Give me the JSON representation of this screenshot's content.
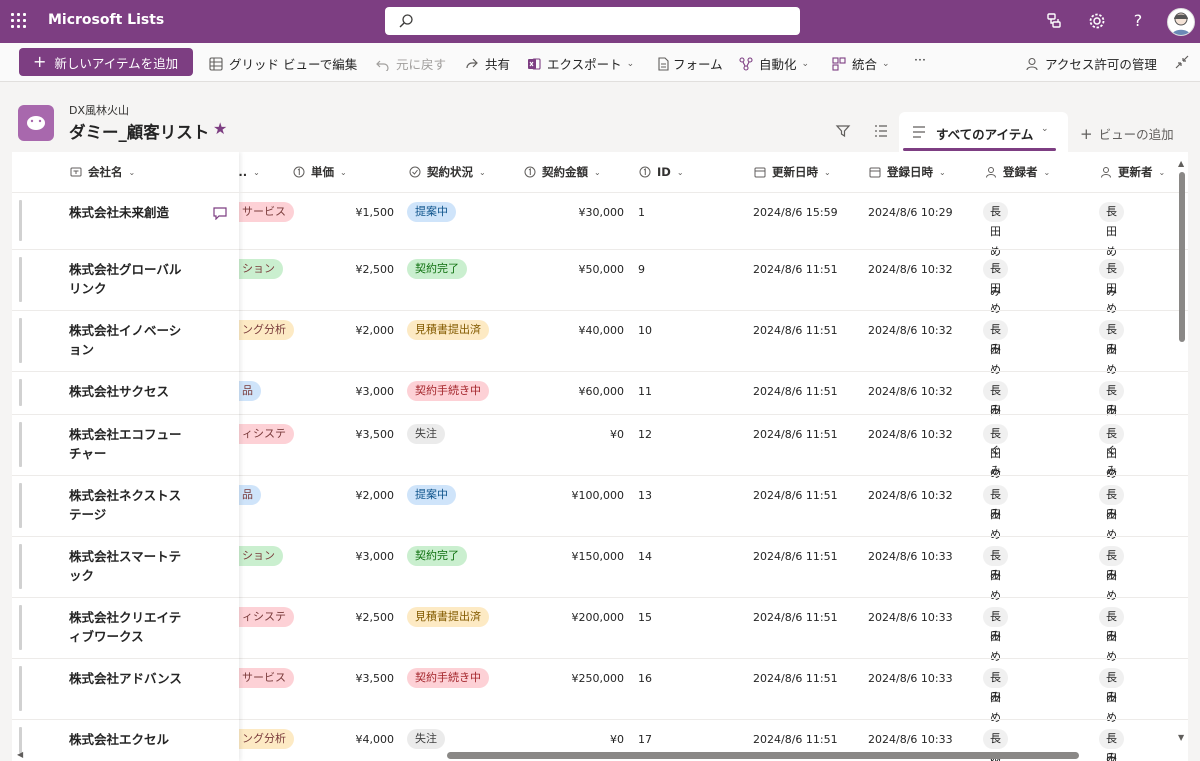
{
  "app": {
    "name": "Microsoft Lists"
  },
  "colors": {
    "brand": "#7d3e82",
    "pill_blue": "#cfe4fa",
    "pill_green": "#caefcf",
    "pill_yellow": "#fdeac4",
    "pill_red": "#fdd1d6",
    "pill_gray": "#ebebeb"
  },
  "commands": {
    "new_item": "新しいアイテムを追加",
    "grid_edit": "グリッド ビューで編集",
    "undo": "元に戻す",
    "share": "共有",
    "export": "エクスポート",
    "form": "フォーム",
    "automate": "自動化",
    "integrate": "統合",
    "more": "···",
    "access": "アクセス許可の管理"
  },
  "header": {
    "site": "DX風林火山",
    "list_title": "ダミー_顧客リスト",
    "view_name": "すべてのアイテム",
    "add_view": "ビューの追加"
  },
  "columns": {
    "company": "会社名",
    "product_trunc": "...",
    "unit_price": "単価",
    "status": "契約状況",
    "amount": "契約金額",
    "id": "ID",
    "modified": "更新日時",
    "created": "登録日時",
    "created_by": "登録者",
    "modified_by": "更新者"
  },
  "rows": [
    {
      "name": "株式会社未来創造",
      "product": "サービス",
      "price": "¥1,500",
      "status": "提案中",
      "amount": "¥30,000",
      "id": "1",
      "modified": "2024/8/6 15:59",
      "created": "2024/8/6 10:29",
      "created_by": "長田めぐみ",
      "modified_by": "長田めぐみ"
    },
    {
      "name": "株式会社グローバルリンク",
      "product": "ション",
      "price": "¥2,500",
      "status": "契約完了",
      "amount": "¥50,000",
      "id": "9",
      "modified": "2024/8/6 11:51",
      "created": "2024/8/6 10:32",
      "created_by": "長田めぐみ",
      "modified_by": "長田めぐみ"
    },
    {
      "name": "株式会社イノベーション",
      "product": "ング分析",
      "price": "¥2,000",
      "status": "見積書提出済",
      "amount": "¥40,000",
      "id": "10",
      "modified": "2024/8/6 11:51",
      "created": "2024/8/6 10:32",
      "created_by": "長田めぐみ",
      "modified_by": "長田めぐみ"
    },
    {
      "name": "株式会社サクセス",
      "product": "品",
      "price": "¥3,000",
      "status": "契約手続き中",
      "amount": "¥60,000",
      "id": "11",
      "modified": "2024/8/6 11:51",
      "created": "2024/8/6 10:32",
      "created_by": "長田めぐみ",
      "modified_by": "長田めぐみ"
    },
    {
      "name": "株式会社エコフューチャー",
      "product": "ィシステ",
      "price": "¥3,500",
      "status": "失注",
      "amount": "¥0",
      "id": "12",
      "modified": "2024/8/6 11:51",
      "created": "2024/8/6 10:32",
      "created_by": "長田めぐみ",
      "modified_by": "長田めぐみ"
    },
    {
      "name": "株式会社ネクストステージ",
      "product": "品",
      "price": "¥2,000",
      "status": "提案中",
      "amount": "¥100,000",
      "id": "13",
      "modified": "2024/8/6 11:51",
      "created": "2024/8/6 10:32",
      "created_by": "長田めぐみ",
      "modified_by": "長田めぐみ"
    },
    {
      "name": "株式会社スマートテック",
      "product": "ション",
      "price": "¥3,000",
      "status": "契約完了",
      "amount": "¥150,000",
      "id": "14",
      "modified": "2024/8/6 11:51",
      "created": "2024/8/6 10:33",
      "created_by": "長田めぐみ",
      "modified_by": "長田めぐみ"
    },
    {
      "name": "株式会社クリエイティブワークス",
      "product": "ィシステ",
      "price": "¥2,500",
      "status": "見積書提出済",
      "amount": "¥200,000",
      "id": "15",
      "modified": "2024/8/6 11:51",
      "created": "2024/8/6 10:33",
      "created_by": "長田めぐみ",
      "modified_by": "長田めぐみ"
    },
    {
      "name": "株式会社アドバンス",
      "product": "サービス",
      "price": "¥3,500",
      "status": "契約手続き中",
      "amount": "¥250,000",
      "id": "16",
      "modified": "2024/8/6 11:51",
      "created": "2024/8/6 10:33",
      "created_by": "長田めぐみ",
      "modified_by": "長田めぐみ"
    },
    {
      "name": "株式会社エクセル",
      "product": "ング分析",
      "price": "¥4,000",
      "status": "失注",
      "amount": "¥0",
      "id": "17",
      "modified": "2024/8/6 11:51",
      "created": "2024/8/6 10:33",
      "created_by": "長田めぐみ",
      "modified_by": "長田めぐみ"
    }
  ]
}
